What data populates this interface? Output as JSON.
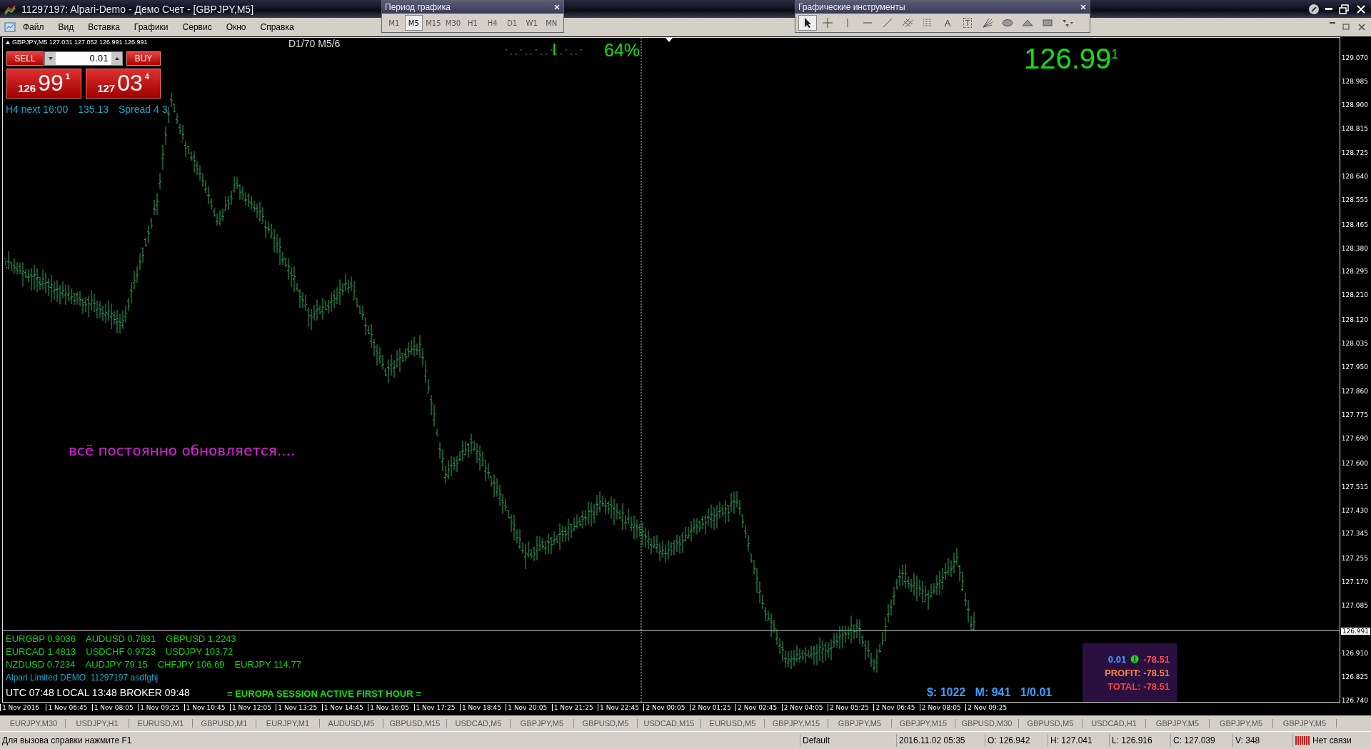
{
  "window": {
    "title": "11297197: Alpari-Demo - Демо Счет - [GBPJPY,M5]"
  },
  "menu": [
    "Файл",
    "Вид",
    "Вставка",
    "Графики",
    "Сервис",
    "Окно",
    "Справка"
  ],
  "period_toolbar": {
    "title": "Период графика",
    "buttons": [
      {
        "label": "M1",
        "selected": false
      },
      {
        "label": "M5",
        "selected": true
      },
      {
        "label": "M15",
        "selected": false
      },
      {
        "label": "M30",
        "selected": false
      },
      {
        "label": "H1",
        "selected": false
      },
      {
        "label": "H4",
        "selected": false
      },
      {
        "label": "D1",
        "selected": false
      },
      {
        "label": "W1",
        "selected": false
      },
      {
        "label": "MN",
        "selected": false
      }
    ]
  },
  "drawing_toolbar": {
    "title": "Графические инструменты",
    "text_tool": "A",
    "label_tool": "T"
  },
  "chart": {
    "symbol_line": "GBPJPY,M5  127.031 127.052 126.991 126.991",
    "counter": "D1/70  M5/6",
    "progress": {
      "level": 0.6,
      "percent": "64%"
    },
    "big_price": {
      "main": "126.99",
      "sup": "1"
    },
    "trade_panel": {
      "sell": "SELL",
      "buy": "BUY",
      "lot": "0.01",
      "bid": {
        "small": "126",
        "big": "99",
        "sup": "1"
      },
      "ask": {
        "small": "127",
        "big": "03",
        "sup": "4"
      }
    },
    "info": [
      "H4 next 16:00",
      "135.13",
      "Spread 4 3"
    ],
    "message": "всё постоянно обновляется....",
    "price_labels": [
      "129.070",
      "128.985",
      "128.900",
      "128.815",
      "128.725",
      "128.640",
      "128.555",
      "128.465",
      "128.380",
      "128.295",
      "128.210",
      "128.120",
      "128.035",
      "127.950",
      "127.860",
      "127.775",
      "127.690",
      "127.600",
      "127.515",
      "127.430",
      "127.345",
      "127.255",
      "127.170",
      "127.085",
      "126.910",
      "126.825",
      "126.740"
    ],
    "current_price": "126.991",
    "time_labels": [
      "1 Nov 2016",
      "1 Nov 06:45",
      "1 Nov 08:05",
      "1 Nov 09:25",
      "1 Nov 10:45",
      "1 Nov 12:05",
      "1 Nov 13:25",
      "1 Nov 14:45",
      "1 Nov 16:05",
      "1 Nov 17:25",
      "1 Nov 18:45",
      "1 Nov 20:05",
      "1 Nov 21:25",
      "1 Nov 22:45",
      "2 Nov 00:05",
      "2 Nov 01:25",
      "2 Nov 02:45",
      "2 Nov 04:05",
      "2 Nov 05:25",
      "2 Nov 06:45",
      "2 Nov 08:05",
      "2 Nov 09:25"
    ],
    "quotes": [
      [
        "EURGBP 0.9036",
        "AUDUSD 0.7631",
        "GBPUSD 1.2243"
      ],
      [
        "EURCAD 1.4813",
        "USDCHF 0.9723",
        "USDJPY 103.72"
      ],
      [
        "NZDUSD 0.7234",
        "AUDJPY 79.15",
        "CHFJPY 106.69",
        "EURJPY 114.77"
      ]
    ],
    "broker": "Alpari Limited  DEMO: 11297197  asdfghj",
    "clock": "UTC 07:48  LOCAL 13:48  BROKER 09:48",
    "session": "= EUROPA SESSION ACTIVE FIRST HOUR =",
    "account": "$: 1022   M: 941   1/0.01",
    "profit_panel": {
      "lots": "0.01",
      "value": "-78.51",
      "profit": "PROFIT: -78.51",
      "total": "TOTAL: -78.51"
    }
  },
  "tabs": [
    "EURJPY,M30",
    "USDJPY,H1",
    "EURUSD,M1",
    "GBPUSD,M1",
    "EURJPY,M1",
    "AUDUSD,M5",
    "GBPUSD,M15",
    "USDCAD,M5",
    "GBPJPY,M5",
    "GBPUSD,M5",
    "USDCAD,M15",
    "EURUSD,M5",
    "GBPJPY,M15",
    "GBPJPY,M5",
    "GBPJPY,M15",
    "GBPUSD,M30",
    "GBPUSD,M5",
    "USDCAD,H1",
    "GBPJPY,M5",
    "GBPJPY,M5",
    "GBPJPY,M5"
  ],
  "status_bar": {
    "help": "Для вызова справки нажмите F1",
    "profile": "Default",
    "datetime": "2016.11.02 05:35",
    "open": "O: 126.942",
    "high": "H: 127.041",
    "low": "L: 126.916",
    "close": "C: 127.039",
    "volume": "V: 348",
    "connection": "Нет связи"
  }
}
